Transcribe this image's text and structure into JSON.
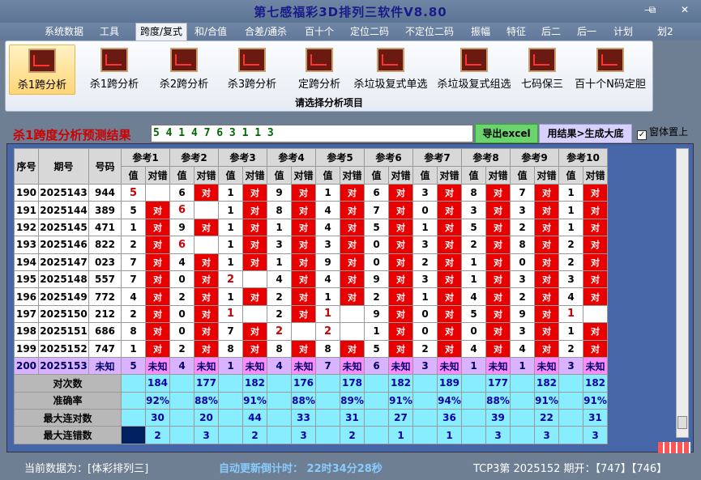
{
  "window": {
    "title": "第七感福彩3D排列三软件V8.80",
    "restore": "⧉",
    "close": "✕"
  },
  "menu": [
    "系统数据",
    "工具",
    "跨度/复式",
    "和/合值",
    "合差/通杀",
    "百十个",
    "定位二码",
    "不定位二码",
    "振幅",
    "特征",
    "后二",
    "后一",
    "计划",
    "划2"
  ],
  "ribbon": {
    "buttons": [
      "杀1跨分析",
      "杀1跨分析",
      "杀2跨分析",
      "杀3跨分析",
      "定跨分析",
      "杀垃圾复式单选",
      "杀垃圾复式组选",
      "七码保三",
      "百十个N码定胆"
    ],
    "caption": "请选择分析项目"
  },
  "result": {
    "title": "杀1跨度分析预测结果",
    "value": "5 4 1 4 7 6 3 1 1 3",
    "excel": "导出excel",
    "generate": "用结果>生成大底",
    "pin": "窗体置上"
  },
  "table": {
    "h_seq": "序号",
    "h_issue": "期号",
    "h_code": "号码",
    "refs": [
      "参考1",
      "参考2",
      "参考3",
      "参考4",
      "参考5",
      "参考6",
      "参考7",
      "参考8",
      "参考9",
      "参考10"
    ],
    "sub_val": "值",
    "sub_ok": "对错",
    "rows": [
      {
        "seq": "190",
        "issue": "2025143",
        "code": "944",
        "v": [
          "5",
          "6",
          "1",
          "9",
          "1",
          "6",
          "3",
          "8",
          "7",
          "1"
        ],
        "ok": [
          0,
          1,
          1,
          1,
          1,
          1,
          1,
          1,
          1,
          1
        ],
        "big": [
          0
        ]
      },
      {
        "seq": "191",
        "issue": "2025144",
        "code": "389",
        "v": [
          "5",
          "6",
          "1",
          "8",
          "4",
          "7",
          "0",
          "3",
          "3",
          "1"
        ],
        "ok": [
          1,
          0,
          1,
          1,
          1,
          1,
          1,
          1,
          1,
          1
        ],
        "big": [
          1
        ]
      },
      {
        "seq": "192",
        "issue": "2025145",
        "code": "471",
        "v": [
          "1",
          "9",
          "1",
          "1",
          "4",
          "5",
          "1",
          "5",
          "2",
          "1"
        ],
        "ok": [
          1,
          1,
          1,
          1,
          1,
          1,
          1,
          1,
          1,
          1
        ],
        "big": []
      },
      {
        "seq": "193",
        "issue": "2025146",
        "code": "822",
        "v": [
          "2",
          "6",
          "1",
          "3",
          "3",
          "0",
          "3",
          "2",
          "8",
          "2"
        ],
        "ok": [
          1,
          0,
          1,
          1,
          1,
          1,
          1,
          1,
          1,
          1
        ],
        "big": [
          1
        ]
      },
      {
        "seq": "194",
        "issue": "2025147",
        "code": "023",
        "v": [
          "7",
          "4",
          "1",
          "1",
          "9",
          "0",
          "2",
          "1",
          "0",
          "2"
        ],
        "ok": [
          1,
          1,
          1,
          1,
          1,
          1,
          1,
          1,
          1,
          1
        ],
        "big": []
      },
      {
        "seq": "195",
        "issue": "2025148",
        "code": "557",
        "v": [
          "7",
          "0",
          "2",
          "4",
          "4",
          "9",
          "3",
          "1",
          "3",
          "3"
        ],
        "ok": [
          1,
          1,
          0,
          1,
          1,
          1,
          1,
          1,
          1,
          1
        ],
        "big": [
          2
        ]
      },
      {
        "seq": "196",
        "issue": "2025149",
        "code": "772",
        "v": [
          "4",
          "2",
          "1",
          "2",
          "1",
          "2",
          "1",
          "4",
          "2",
          "4"
        ],
        "ok": [
          1,
          1,
          1,
          1,
          1,
          1,
          1,
          1,
          1,
          1
        ],
        "big": []
      },
      {
        "seq": "197",
        "issue": "2025150",
        "code": "212",
        "v": [
          "2",
          "0",
          "1",
          "2",
          "1",
          "9",
          "0",
          "5",
          "9",
          "1"
        ],
        "ok": [
          1,
          1,
          0,
          1,
          0,
          1,
          1,
          1,
          1,
          0
        ],
        "big": [
          2,
          4,
          9
        ]
      },
      {
        "seq": "198",
        "issue": "2025151",
        "code": "686",
        "v": [
          "8",
          "0",
          "7",
          "2",
          "2",
          "1",
          "0",
          "0",
          "3",
          "1"
        ],
        "ok": [
          1,
          1,
          1,
          0,
          0,
          1,
          1,
          1,
          1,
          1
        ],
        "big": [
          3,
          4
        ]
      },
      {
        "seq": "199",
        "issue": "2025152",
        "code": "747",
        "v": [
          "1",
          "2",
          "8",
          "8",
          "8",
          "5",
          "2",
          "4",
          "4",
          "2"
        ],
        "ok": [
          1,
          1,
          1,
          1,
          1,
          1,
          1,
          1,
          1,
          1
        ],
        "big": []
      }
    ],
    "unknown": {
      "seq": "200",
      "issue": "2025153",
      "code": "未知",
      "v": [
        "5",
        "4",
        "1",
        "4",
        "7",
        "6",
        "3",
        "1",
        "1",
        "3"
      ],
      "ok_label": "未知"
    },
    "stats": [
      {
        "label": "对次数",
        "vals": [
          "184",
          "177",
          "182",
          "176",
          "178",
          "182",
          "189",
          "177",
          "182",
          "182"
        ]
      },
      {
        "label": "准确率",
        "vals": [
          "92%",
          "88%",
          "91%",
          "88%",
          "89%",
          "91%",
          "94%",
          "88%",
          "91%",
          "91%"
        ]
      },
      {
        "label": "最大连对数",
        "vals": [
          "30",
          "20",
          "44",
          "33",
          "31",
          "27",
          "36",
          "39",
          "22",
          "31"
        ]
      },
      {
        "label": "最大连错数",
        "vals": [
          "2",
          "3",
          "2",
          "3",
          "2",
          "1",
          "1",
          "3",
          "3",
          "3"
        ]
      }
    ],
    "ok_text": "对"
  },
  "status": {
    "current": "当前数据为：[体彩排列三]",
    "countdown": "自动更新倒计时： 22时34分28秒",
    "tcp": "TCP3第 2025152 期开：【747】【746】"
  },
  "colors": {
    "hit": "#e80000",
    "unknown": "#ff8cff",
    "stats": "#88eeff"
  }
}
